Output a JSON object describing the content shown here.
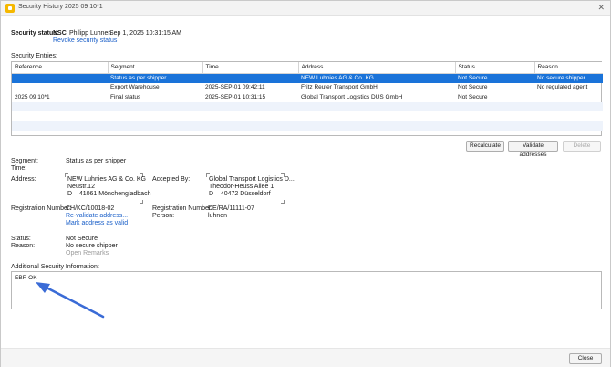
{
  "window": {
    "title": "Security History 2025 09 10*1"
  },
  "header": {
    "status_label": "Security status:",
    "status_code": "NSC",
    "user": "Philipp Luhnen",
    "timestamp": "Sep 1, 2025 10:31:15 AM",
    "revoke_link": "Revoke security status"
  },
  "entries": {
    "label": "Security Entries:",
    "columns": [
      "Reference",
      "Segment",
      "Time",
      "Address",
      "Status",
      "Reason"
    ],
    "rows": [
      [
        "",
        "Status as per shipper",
        "",
        "NEW Luhnies AG & Co. KG",
        "Not Secure",
        "No secure shipper"
      ],
      [
        "",
        "Export Warehouse",
        "2025-SEP-01 09:42:11",
        "Fritz Reuter Transport GmbH",
        "Not Secure",
        "No regulated agent"
      ],
      [
        "2025 09 10*1",
        "Final status",
        "2025-SEP-01 10:31:15",
        "Global Transport Logistics DUS GmbH",
        "Not Secure",
        ""
      ]
    ]
  },
  "buttons": {
    "recalculate": "Recalculate",
    "validate": "Validate addresses",
    "delete": "Delete",
    "close": "Close"
  },
  "details": {
    "segment_label": "Segment:",
    "segment_value": "Status as per shipper",
    "time_label": "Time:",
    "address_label": "Address:",
    "address_lines": [
      "NEW Luhnies AG & Co. KG",
      "Neustr.12",
      "D – 41061 Mönchengladbach"
    ],
    "accepted_label": "Accepted By:",
    "accepted_lines": [
      "Global Transport Logistics D...",
      "Theodor-Heuss Allee 1",
      "D – 40472 Düsseldorf"
    ],
    "reg_label": "Registration Number:",
    "reg_value": "CH/KC/10018-02",
    "revalidate_link": "Re-validate address...",
    "mark_valid_link": "Mark address as valid",
    "reg2_label": "Registration Number:",
    "reg2_value": "DE/RA/11111-07",
    "person_label": "Person:",
    "person_value": "luhnen",
    "status_label": "Status:",
    "status_value": "Not Secure",
    "reason_label": "Reason:",
    "reason_value": "No secure shipper",
    "open_remarks": "Open Remarks"
  },
  "additional": {
    "label": "Additional Security Information:",
    "value": "EBR OK"
  },
  "colors": {
    "selection": "#1a73d9",
    "link": "#1a5fc8",
    "arrow": "#3a6bd6"
  }
}
